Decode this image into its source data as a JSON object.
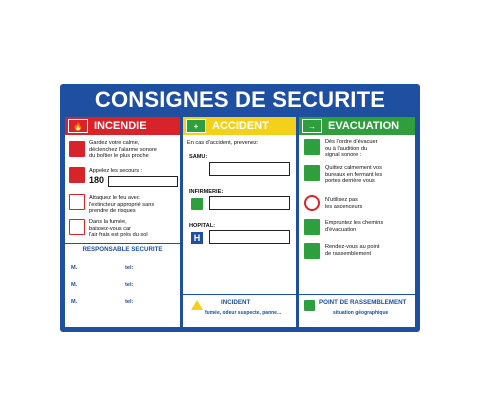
{
  "title": "CONSIGNES DE SECURITE",
  "colors": {
    "blue": "#1e4fa0",
    "red": "#d8232a",
    "yellow": "#f3d11a",
    "green": "#2f9e3c"
  },
  "incendie": {
    "header": "INCENDIE",
    "items": [
      {
        "icon": "fire-alarm-icon",
        "lines": [
          "Gardez votre calme,",
          "déclenchez l'alarme sonore",
          "du boîtier le plus proche"
        ]
      },
      {
        "icon": "phone-icon",
        "lines": [
          "Appelez les secours :"
        ]
      },
      {
        "icon": "extinguisher-icon",
        "lines": [
          "Attaquez le feu avec",
          "l'extincteur approprié sans",
          "prendre de risques"
        ]
      },
      {
        "icon": "crawl-smoke-icon",
        "lines": [
          "Dans la fumée,",
          "baissez-vous car",
          "l'air frais est près du sol"
        ]
      }
    ],
    "phone_number": "180",
    "responsable": {
      "title": "RESPONSABLE SECURITE",
      "rows": [
        {
          "m": "M.",
          "tel": "tel:"
        },
        {
          "m": "M.",
          "tel": "tel:"
        },
        {
          "m": "M.",
          "tel": "tel:"
        }
      ]
    }
  },
  "accident": {
    "header": "ACCIDENT",
    "intro": "En cas d'accident, prevenez:",
    "samu": "SAMU:",
    "infirmerie": "INFIRMERIE:",
    "hopital": "HOPITAL:",
    "hopital_icon_letter": "H",
    "incident_title": "INCIDENT",
    "incident_sub": "fumée, odeur suspecte, panne..."
  },
  "evacuation": {
    "header": "EVACUATION",
    "items": [
      {
        "icon": "alarm-bell-icon",
        "lines": [
          "Dès l'ordre d'évacuer",
          "ou à l'audition du",
          "signal sonore :"
        ]
      },
      {
        "icon": "exit-door-icon",
        "lines": [
          "Quittez calmement vos",
          "bureaux en fermant les",
          "portes derrière vous"
        ]
      },
      {
        "icon": "no-elevator-icon",
        "lines": [
          "N'utilisez pas",
          "les ascenceurs"
        ]
      },
      {
        "icon": "stairs-icon",
        "lines": [
          "Empruntez les chemins",
          "d'évacuation"
        ]
      },
      {
        "icon": "assembly-point-icon",
        "lines": [
          "Rendez-vous au point",
          "de rassemblement"
        ]
      }
    ],
    "rassemblement_title": "POINT DE RASSEMBLEMENT",
    "rassemblement_sub": "situation géographique"
  }
}
